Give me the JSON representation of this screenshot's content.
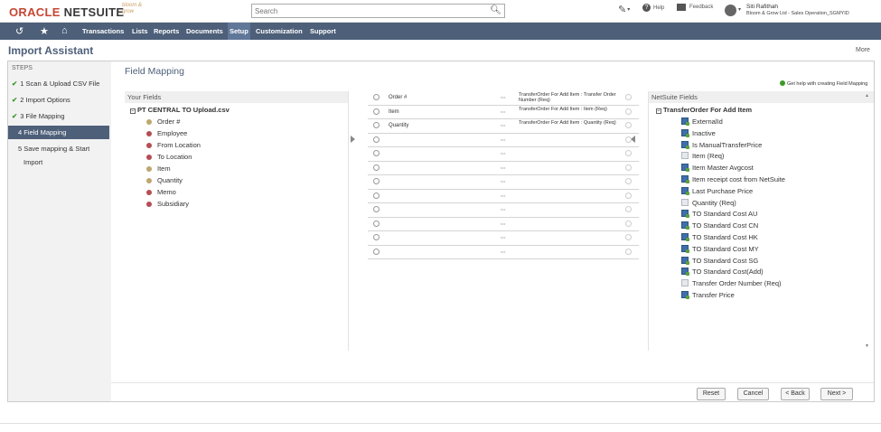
{
  "header": {
    "logo_oracle": "ORACLE",
    "logo_netsuite": "NETSUITE",
    "brand_secondary": "bloom & grow",
    "search_placeholder": "Search",
    "help_label": "Help",
    "feedback_label": "Feedback",
    "user_name": "Siti Rafithah",
    "user_role": "Bloom & Grow Ltd - Sales Operation_SGMYID"
  },
  "nav": {
    "items": [
      "Transactions",
      "Lists",
      "Reports",
      "Documents",
      "Setup",
      "Customization",
      "Support"
    ],
    "active": "Setup"
  },
  "page": {
    "title": "Import Assistant",
    "more": "More"
  },
  "steps": {
    "heading": "STEPS",
    "items": [
      {
        "label": "1 Scan & Upload CSV File",
        "done": true
      },
      {
        "label": "2 Import Options",
        "done": true
      },
      {
        "label": "3 File Mapping",
        "done": true
      },
      {
        "label": "4 Field Mapping",
        "active": true
      },
      {
        "label": "5 Save mapping & Start",
        "done": false
      },
      {
        "label": "Import",
        "done": false
      }
    ]
  },
  "mapping": {
    "title": "Field Mapping",
    "help_link": "Get help with creating Field Mapping",
    "your_fields_header": "Your Fields",
    "file_name": "PT CENTRAL TO Upload.csv",
    "your_fields": [
      "Order #",
      "Employee",
      "From Location",
      "To Location",
      "Item",
      "Quantity",
      "Memo",
      "Subsidiary"
    ],
    "rows": [
      {
        "source": "Order #",
        "target": "TransferOrder For Add Item : Transfer Order Number (Req)"
      },
      {
        "source": "Item",
        "target": "TransferOrder For Add Item : Item (Req)"
      },
      {
        "source": "Quantity",
        "target": "TransferOrder For Add Item : Quantity (Req)"
      },
      {
        "source": "",
        "target": ""
      },
      {
        "source": "",
        "target": ""
      },
      {
        "source": "",
        "target": ""
      },
      {
        "source": "",
        "target": ""
      },
      {
        "source": "",
        "target": ""
      },
      {
        "source": "",
        "target": ""
      },
      {
        "source": "",
        "target": ""
      },
      {
        "source": "",
        "target": ""
      },
      {
        "source": "",
        "target": ""
      }
    ],
    "netsuite_fields_header": "NetSuite Fields",
    "record_name": "TransferOrder For Add Item",
    "netsuite_fields": [
      "ExternalId",
      "Inactive",
      "Is ManualTransferPrice",
      "Item (Req)",
      "Item Master Avgcost",
      "Item receipt cost from NetSuite",
      "Last Purchase Price",
      "Quantity (Req)",
      "TO Standard Cost AU",
      "TO Standard Cost CN",
      "TO Standard Cost HK",
      "TO Standard Cost MY",
      "TO Standard Cost SG",
      "TO Standard Cost(Add)",
      "Transfer Order Number (Req)",
      "Transfer Price"
    ]
  },
  "footer": {
    "reset": "Reset",
    "cancel": "Cancel",
    "back": "< Back",
    "next": "Next >"
  }
}
